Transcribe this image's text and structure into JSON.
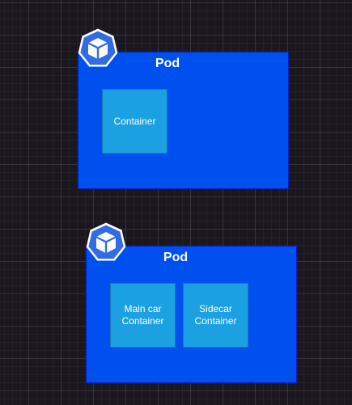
{
  "diagram": {
    "pods": [
      {
        "title": "Pod",
        "icon": "kubernetes-pod-icon",
        "containers": [
          {
            "label": "Container"
          }
        ]
      },
      {
        "title": "Pod",
        "icon": "kubernetes-pod-icon",
        "containers": [
          {
            "label": "Main car\nContainer"
          },
          {
            "label": "Sidecar\nContainer"
          }
        ]
      }
    ]
  },
  "colors": {
    "background": "#1b171f",
    "pod_fill": "#0050ef",
    "container_fill": "#1ba1e2",
    "icon_fill": "#326ce5",
    "text": "#ffffff"
  }
}
